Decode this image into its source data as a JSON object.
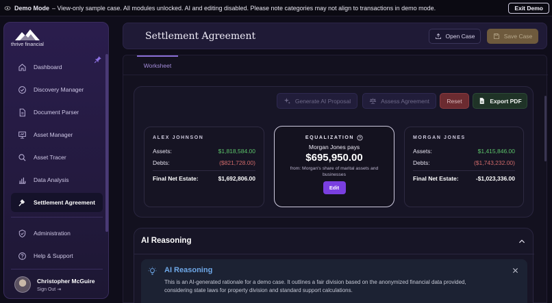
{
  "banner": {
    "label": "Demo Mode",
    "message": "– View-only sample case. All modules unlocked. AI and editing disabled. Please note categories may not align to transactions in demo mode.",
    "exit_label": "Exit Demo"
  },
  "sidebar": {
    "logo_text": "thrive financial",
    "items": [
      {
        "label": "Dashboard",
        "icon": "home-icon"
      },
      {
        "label": "Discovery Manager",
        "icon": "check-circle-icon"
      },
      {
        "label": "Document Parser",
        "icon": "document-icon"
      },
      {
        "label": "Asset Manager",
        "icon": "presentation-icon"
      },
      {
        "label": "Asset Tracer",
        "icon": "search-icon"
      },
      {
        "label": "Data Analysis",
        "icon": "bar-chart-icon"
      },
      {
        "label": "Settlement Agreement",
        "icon": "gavel-icon"
      },
      {
        "label": "Administration",
        "icon": "shield-icon"
      },
      {
        "label": "Help & Support",
        "icon": "help-circle-icon"
      }
    ],
    "user": {
      "name": "Christopher McGuire",
      "sign_out": "Sign Out"
    }
  },
  "header": {
    "title": "Settlement Agreement",
    "open_case": "Open Case",
    "save_case": "Save Case"
  },
  "tabs": [
    {
      "label": "Worksheet",
      "active": true
    }
  ],
  "toolbar": {
    "generate": "Generate AI Proposal",
    "assess": "Assess Agreement",
    "reset": "Reset",
    "export": "Export PDF"
  },
  "left_party": {
    "name": "ALEX JOHNSON",
    "assets_label": "Assets:",
    "assets": "$1,818,584.00",
    "debts_label": "Debts:",
    "debts": "($821,728.00)",
    "net_label": "Final Net Estate:",
    "net": "$1,692,806.00"
  },
  "equalization": {
    "title": "EQUALIZATION",
    "payer": "Morgan Jones pays",
    "amount": "$695,950.00",
    "note": "from: Morgan's share of marital assets and businesses",
    "edit": "Edit"
  },
  "right_party": {
    "name": "MORGAN JONES",
    "assets_label": "Assets:",
    "assets": "$1,415,846.00",
    "debts_label": "Debts:",
    "debts": "($1,743,232.00)",
    "net_label": "Final Net Estate:",
    "net": "-$1,023,336.00"
  },
  "ai_reasoning": {
    "heading": "AI Reasoning",
    "card_title": "AI Reasoning",
    "card_body": "This is an AI-generated rationale for a demo case. It outlines a fair division based on the anonymized financial data provided, considering state laws for property division and standard support calculations."
  },
  "colors": {
    "accent": "#7a3fe0",
    "positive": "#5cc46a",
    "negative": "#d06a6a",
    "info": "#6ea8e8"
  }
}
